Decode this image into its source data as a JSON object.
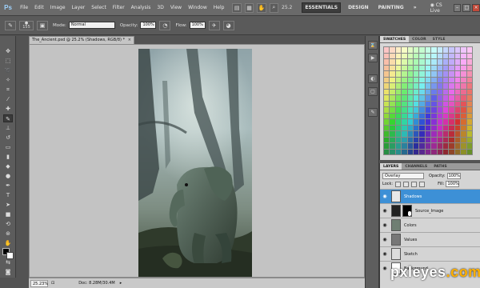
{
  "menubar": {
    "logo": "Ps",
    "items": [
      "File",
      "Edit",
      "Image",
      "Layer",
      "Select",
      "Filter",
      "Analysis",
      "3D",
      "View",
      "Window",
      "Help"
    ],
    "zoom": "25.2",
    "workspaces": [
      "ESSENTIALS",
      "DESIGN",
      "PAINTING"
    ],
    "more": "»",
    "cslive": "CS Live",
    "window_buttons": [
      "–",
      "□",
      "×"
    ]
  },
  "options": {
    "brush_size": "155",
    "mode_label": "Mode:",
    "mode_value": "Normal",
    "opacity_label": "Opacity:",
    "opacity_value": "100%",
    "flow_label": "Flow:",
    "flow_value": "100%"
  },
  "document": {
    "tab_title": "The_Ancient.psd @ 25.2% (Shadows, RGB/8) *",
    "status_zoom": "25.23%",
    "status_doc": "Doc: 8.28M/30.4M"
  },
  "swatches_panel": {
    "tabs": [
      "SWATCHES",
      "COLOR",
      "STYLE"
    ]
  },
  "layers_panel": {
    "tabs": [
      "LAYERS",
      "CHANNELS",
      "PATHS"
    ],
    "blend_mode": "Overlay",
    "opacity_label": "Opacity:",
    "opacity_value": "100%",
    "lock_label": "Lock:",
    "fill_label": "Fill:",
    "fill_value": "100%",
    "layers": [
      {
        "name": "Shadows",
        "selected": true
      },
      {
        "name": "Source_Image",
        "selected": false
      },
      {
        "name": "Colors",
        "selected": false
      },
      {
        "name": "Values",
        "selected": false
      },
      {
        "name": "Sketch",
        "selected": false
      },
      {
        "name": "Background",
        "selected": false
      }
    ]
  },
  "watermark": {
    "text": "pxleyes",
    "suffix": ".com"
  }
}
